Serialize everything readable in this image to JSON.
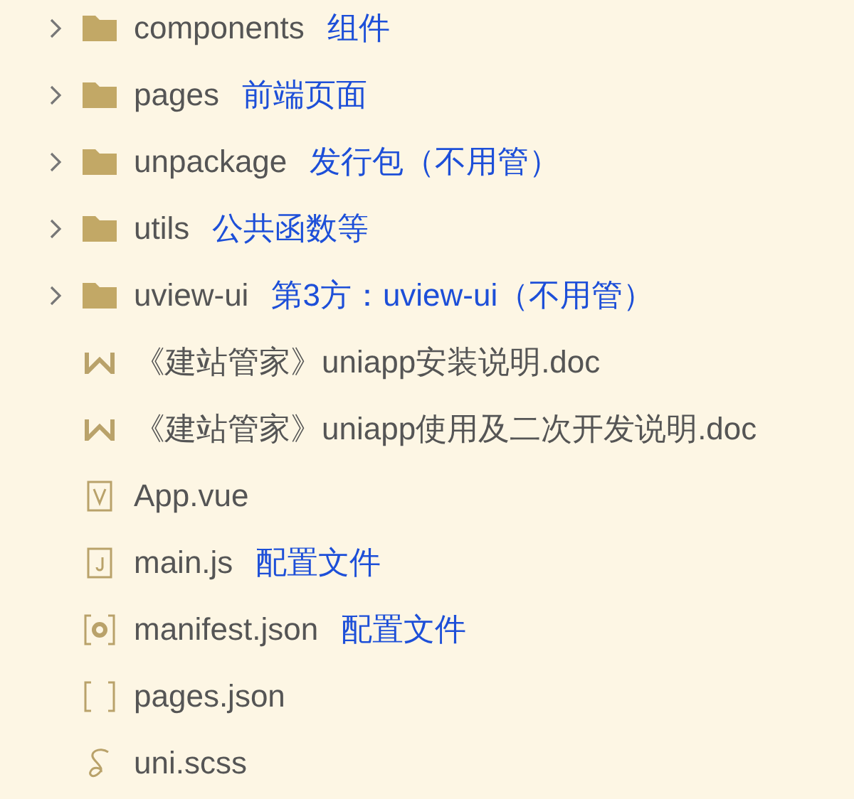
{
  "items": [
    {
      "kind": "folder",
      "name": "components",
      "note": "组件",
      "expanded": false
    },
    {
      "kind": "folder",
      "name": "pages",
      "note": "前端页面",
      "expanded": false
    },
    {
      "kind": "folder",
      "name": "unpackage",
      "note": "发行包（不用管）",
      "expanded": false
    },
    {
      "kind": "folder",
      "name": "utils",
      "note": "公共函数等",
      "expanded": false
    },
    {
      "kind": "folder",
      "name": "uview-ui",
      "note": "第3方：uview-ui（不用管）",
      "expanded": false
    },
    {
      "kind": "doc",
      "name": "《建站管家》uniapp安装说明.doc"
    },
    {
      "kind": "doc",
      "name": "《建站管家》uniapp使用及二次开发说明.doc"
    },
    {
      "kind": "vue",
      "name": "App.vue"
    },
    {
      "kind": "js",
      "name": "main.js",
      "note": "配置文件"
    },
    {
      "kind": "settings",
      "name": "manifest.json",
      "note": "配置文件"
    },
    {
      "kind": "json",
      "name": "pages.json"
    },
    {
      "kind": "scss",
      "name": "uni.scss"
    }
  ]
}
